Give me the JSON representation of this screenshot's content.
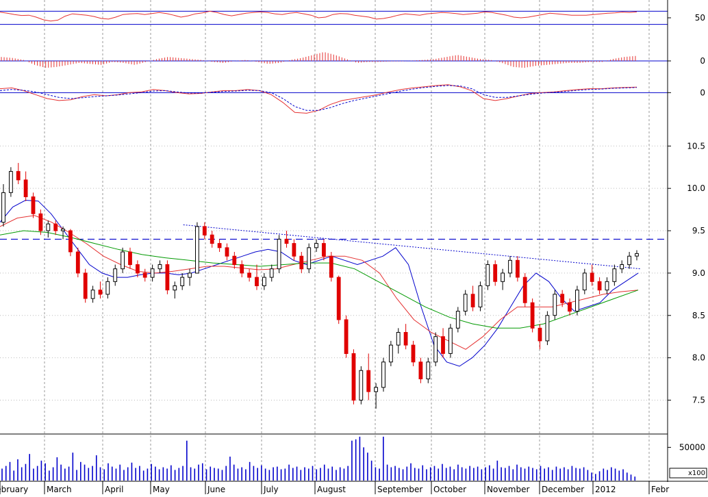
{
  "chart_data": [
    {
      "type": "line",
      "panel": "oscillator",
      "y_ticks": [
        {
          "value": 50,
          "label": "50"
        }
      ],
      "ylim": [
        0,
        100
      ],
      "reference_lines": [
        70,
        30
      ],
      "series": [
        {
          "color": "#e53030",
          "values": [
            67,
            64,
            60,
            57,
            58,
            52,
            44,
            40,
            43,
            55,
            62,
            60,
            58,
            54,
            48,
            46,
            52,
            60,
            62,
            63,
            60,
            63,
            66,
            63,
            58,
            52,
            56,
            62,
            65,
            70,
            66,
            60,
            56,
            60,
            64,
            66,
            68,
            66,
            62,
            60,
            64,
            66,
            62,
            58,
            50,
            52,
            60,
            63,
            62,
            58,
            55,
            52,
            46,
            48,
            52,
            58,
            62,
            60,
            58,
            62,
            64,
            66,
            65,
            63,
            60,
            62,
            64,
            68,
            66,
            62,
            58,
            52,
            50,
            52,
            56,
            60,
            64,
            62,
            60,
            58,
            58,
            58,
            60,
            62,
            64,
            65,
            67,
            66,
            68
          ]
        }
      ]
    },
    {
      "type": "bar",
      "panel": "histogram",
      "y_ticks": [
        {
          "value": 0,
          "label": "0"
        }
      ],
      "ylim": [
        -1,
        1
      ],
      "series": [
        {
          "color": "#e53030",
          "values": [
            0.2,
            0.15,
            0.05,
            -0.2,
            -0.35,
            -0.3,
            -0.2,
            -0.1,
            -0.15,
            -0.2,
            -0.05,
            -0.1,
            -0.2,
            -0.05,
            0.1,
            0.2,
            0.15,
            0.1,
            0.05,
            -0.05,
            -0.1,
            0.0,
            0.05,
            -0.05,
            -0.15,
            -0.1,
            0.05,
            0.15,
            0.3,
            0.45,
            0.3,
            0.1,
            -0.1,
            -0.05,
            -0.05,
            -0.02,
            -0.02,
            0.02,
            0.05,
            0.1,
            0.2,
            0.3,
            0.2,
            0.1,
            0.05,
            -0.1,
            -0.3,
            -0.35,
            -0.25,
            -0.2,
            -0.15,
            -0.1,
            -0.1,
            -0.05,
            -0.05,
            0.1,
            0.2,
            0.25
          ]
        }
      ]
    },
    {
      "type": "line",
      "panel": "macd",
      "y_ticks": [
        {
          "value": 0,
          "label": "0"
        }
      ],
      "ylim": [
        -0.6,
        0.3
      ],
      "series": [
        {
          "color": "#e53030",
          "values": [
            0.1,
            0.12,
            0.05,
            -0.05,
            -0.15,
            -0.2,
            -0.18,
            -0.1,
            -0.05,
            -0.08,
            -0.05,
            0.0,
            0.02,
            0.08,
            0.05,
            0.0,
            -0.03,
            -0.02,
            0.02,
            0.05,
            0.05,
            0.08,
            0.05,
            -0.05,
            -0.25,
            -0.5,
            -0.52,
            -0.45,
            -0.3,
            -0.2,
            -0.15,
            -0.1,
            -0.05,
            0.02,
            0.08,
            0.12,
            0.15,
            0.18,
            0.2,
            0.15,
            0.05,
            -0.15,
            -0.2,
            -0.15,
            -0.08,
            -0.02,
            0.0,
            0.02,
            0.05,
            0.08,
            0.1,
            0.1,
            0.12,
            0.13,
            0.14
          ]
        },
        {
          "color": "#0000cc",
          "dashed": true,
          "values": [
            0.05,
            0.08,
            0.06,
            0.02,
            -0.05,
            -0.12,
            -0.15,
            -0.13,
            -0.1,
            -0.08,
            -0.06,
            -0.03,
            0.0,
            0.04,
            0.05,
            0.02,
            -0.01,
            -0.01,
            0.01,
            0.03,
            0.04,
            0.06,
            0.05,
            0.0,
            -0.15,
            -0.35,
            -0.45,
            -0.45,
            -0.38,
            -0.28,
            -0.2,
            -0.14,
            -0.08,
            -0.02,
            0.04,
            0.09,
            0.13,
            0.16,
            0.18,
            0.17,
            0.1,
            -0.05,
            -0.12,
            -0.12,
            -0.08,
            -0.04,
            -0.01,
            0.01,
            0.03,
            0.06,
            0.08,
            0.09,
            0.11,
            0.12,
            0.13
          ]
        }
      ]
    },
    {
      "type": "candlestick",
      "panel": "price",
      "y_ticks": [
        {
          "value": 10.5,
          "label": "10.5"
        },
        {
          "value": 10.0,
          "label": "10.0"
        },
        {
          "value": 9.5,
          "label": "9.5"
        },
        {
          "value": 9.0,
          "label": "9.0"
        },
        {
          "value": 8.5,
          "label": "8.5"
        },
        {
          "value": 8.0,
          "label": "8.0"
        },
        {
          "value": 7.5,
          "label": "7.5"
        }
      ],
      "ylim": [
        7.1,
        10.85
      ],
      "candles": [
        [
          9.6,
          10.05,
          9.55,
          9.95
        ],
        [
          9.95,
          10.25,
          9.9,
          10.2
        ],
        [
          10.2,
          10.3,
          10.05,
          10.1
        ],
        [
          10.1,
          10.2,
          9.85,
          9.9
        ],
        [
          9.9,
          9.95,
          9.65,
          9.7
        ],
        [
          9.7,
          9.75,
          9.45,
          9.5
        ],
        [
          9.5,
          9.62,
          9.42,
          9.58
        ],
        [
          9.58,
          9.62,
          9.45,
          9.5
        ],
        [
          9.5,
          9.55,
          9.4,
          9.52
        ],
        [
          9.5,
          9.52,
          9.2,
          9.25
        ],
        [
          9.25,
          9.3,
          8.95,
          9.0
        ],
        [
          9.0,
          9.05,
          8.65,
          8.7
        ],
        [
          8.7,
          8.85,
          8.65,
          8.8
        ],
        [
          8.8,
          8.9,
          8.7,
          8.75
        ],
        [
          8.75,
          8.95,
          8.7,
          8.9
        ],
        [
          8.9,
          9.1,
          8.85,
          9.05
        ],
        [
          9.05,
          9.3,
          9.0,
          9.25
        ],
        [
          9.25,
          9.3,
          9.05,
          9.1
        ],
        [
          9.1,
          9.15,
          8.95,
          9.0
        ],
        [
          9.0,
          9.05,
          8.9,
          8.95
        ],
        [
          8.95,
          9.1,
          8.9,
          9.05
        ],
        [
          9.05,
          9.15,
          9.0,
          9.1
        ],
        [
          9.1,
          9.15,
          8.75,
          8.8
        ],
        [
          8.8,
          8.9,
          8.7,
          8.85
        ],
        [
          8.85,
          9.0,
          8.8,
          8.95
        ],
        [
          8.95,
          9.05,
          8.85,
          9.0
        ],
        [
          9.0,
          9.6,
          9.0,
          9.55
        ],
        [
          9.55,
          9.6,
          9.4,
          9.45
        ],
        [
          9.45,
          9.5,
          9.3,
          9.35
        ],
        [
          9.35,
          9.4,
          9.25,
          9.3
        ],
        [
          9.3,
          9.35,
          9.15,
          9.2
        ],
        [
          9.2,
          9.25,
          9.05,
          9.1
        ],
        [
          9.1,
          9.15,
          8.95,
          9.0
        ],
        [
          9.0,
          9.05,
          8.9,
          8.95
        ],
        [
          8.95,
          9.1,
          8.8,
          8.85
        ],
        [
          8.85,
          9.0,
          8.8,
          8.95
        ],
        [
          8.95,
          9.1,
          8.9,
          9.05
        ],
        [
          9.05,
          9.45,
          9.0,
          9.4
        ],
        [
          9.4,
          9.5,
          9.3,
          9.35
        ],
        [
          9.35,
          9.4,
          9.15,
          9.2
        ],
        [
          9.2,
          9.25,
          9.0,
          9.05
        ],
        [
          9.05,
          9.35,
          9.0,
          9.3
        ],
        [
          9.3,
          9.4,
          9.25,
          9.35
        ],
        [
          9.35,
          9.4,
          9.15,
          9.2
        ],
        [
          9.2,
          9.25,
          8.9,
          8.95
        ],
        [
          8.95,
          8.97,
          8.4,
          8.45
        ],
        [
          8.45,
          8.5,
          8.0,
          8.05
        ],
        [
          8.05,
          8.1,
          7.45,
          7.5
        ],
        [
          7.5,
          7.9,
          7.45,
          7.85
        ],
        [
          7.85,
          8.05,
          7.5,
          7.6
        ],
        [
          7.6,
          7.7,
          7.4,
          7.65
        ],
        [
          7.65,
          8.0,
          7.6,
          7.95
        ],
        [
          7.95,
          8.2,
          7.9,
          8.15
        ],
        [
          8.15,
          8.35,
          8.05,
          8.3
        ],
        [
          8.3,
          8.4,
          8.1,
          8.15
        ],
        [
          8.15,
          8.2,
          7.9,
          7.95
        ],
        [
          7.95,
          8.0,
          7.7,
          7.75
        ],
        [
          7.75,
          8.0,
          7.7,
          7.95
        ],
        [
          7.95,
          8.3,
          7.9,
          8.25
        ],
        [
          8.25,
          8.35,
          8.0,
          8.05
        ],
        [
          8.05,
          8.4,
          8.0,
          8.35
        ],
        [
          8.35,
          8.6,
          8.3,
          8.55
        ],
        [
          8.55,
          8.8,
          8.5,
          8.75
        ],
        [
          8.75,
          8.85,
          8.55,
          8.6
        ],
        [
          8.6,
          8.9,
          8.55,
          8.85
        ],
        [
          8.85,
          9.15,
          8.8,
          9.1
        ],
        [
          9.1,
          9.15,
          8.85,
          8.9
        ],
        [
          8.9,
          9.05,
          8.8,
          9.0
        ],
        [
          9.0,
          9.2,
          8.95,
          9.15
        ],
        [
          9.15,
          9.2,
          8.9,
          8.95
        ],
        [
          8.95,
          9.0,
          8.6,
          8.65
        ],
        [
          8.65,
          8.7,
          8.3,
          8.35
        ],
        [
          8.35,
          8.4,
          8.1,
          8.2
        ],
        [
          8.2,
          8.55,
          8.15,
          8.5
        ],
        [
          8.5,
          8.8,
          8.45,
          8.75
        ],
        [
          8.75,
          8.8,
          8.6,
          8.65
        ],
        [
          8.65,
          8.7,
          8.5,
          8.55
        ],
        [
          8.55,
          8.85,
          8.5,
          8.8
        ],
        [
          8.8,
          9.05,
          8.75,
          9.0
        ],
        [
          9.0,
          9.1,
          8.85,
          8.9
        ],
        [
          8.9,
          8.95,
          8.75,
          8.8
        ],
        [
          8.8,
          8.95,
          8.75,
          8.9
        ],
        [
          8.9,
          9.1,
          8.85,
          9.05
        ],
        [
          9.05,
          9.15,
          9.0,
          9.1
        ],
        [
          9.1,
          9.25,
          9.05,
          9.2
        ],
        [
          9.2,
          9.27,
          9.15,
          9.23
        ]
      ],
      "reference_lines": [
        {
          "value": 9.4,
          "color": "#0000cc",
          "style": "dashed"
        }
      ],
      "trendline": {
        "from": [
          9.57,
          0.29
        ],
        "to": [
          9.05,
          0.995
        ],
        "color": "#0000cc"
      },
      "series": [
        {
          "color": "#0000cc",
          "values": [
            9.6,
            9.78,
            9.86,
            9.85,
            9.7,
            9.5,
            9.3,
            9.1,
            9.0,
            8.95,
            8.95,
            8.98,
            9.0,
            9.0,
            8.98,
            9.0,
            9.05,
            9.1,
            9.15,
            9.2,
            9.25,
            9.28,
            9.25,
            9.15,
            9.1,
            9.15,
            9.2,
            9.15,
            9.1,
            9.15,
            9.2,
            9.3,
            9.1,
            8.6,
            8.15,
            7.95,
            7.9,
            8.0,
            8.15,
            8.35,
            8.6,
            8.85,
            9.0,
            8.9,
            8.7,
            8.55,
            8.6,
            8.65,
            8.8,
            8.9,
            9.0
          ]
        },
        {
          "color": "#e53030",
          "values": [
            9.55,
            9.65,
            9.68,
            9.6,
            9.48,
            9.35,
            9.2,
            9.1,
            9.02,
            9.0,
            9.02,
            9.05,
            9.08,
            9.08,
            9.06,
            9.04,
            9.05,
            9.1,
            9.15,
            9.2,
            9.2,
            9.15,
            9.0,
            8.7,
            8.45,
            8.3,
            8.2,
            8.1,
            8.25,
            8.45,
            8.6,
            8.6,
            8.6,
            8.65,
            8.7,
            8.75,
            8.78,
            8.8
          ]
        },
        {
          "color": "#009900",
          "values": [
            9.45,
            9.5,
            9.48,
            9.42,
            9.35,
            9.28,
            9.22,
            9.18,
            9.15,
            9.12,
            9.1,
            9.08,
            9.1,
            9.12,
            9.12,
            9.05,
            8.9,
            8.75,
            8.6,
            8.48,
            8.4,
            8.35,
            8.35,
            8.4,
            8.5,
            8.6,
            8.7,
            8.8
          ]
        }
      ]
    },
    {
      "type": "bar",
      "panel": "volume",
      "y_ticks": [
        {
          "value": 50000,
          "label": "50000"
        }
      ],
      "unit_label": "x100",
      "ylim": [
        0,
        70000
      ],
      "series": [
        {
          "color": "#0000cc",
          "values": [
            18000,
            22000,
            28000,
            15000,
            32000,
            20000,
            25000,
            40000,
            18000,
            22000,
            30000,
            26000,
            15000,
            20000,
            35000,
            24000,
            18000,
            21000,
            42000,
            16000,
            28000,
            24000,
            19000,
            22000,
            38000,
            20000,
            17000,
            26000,
            21000,
            18000,
            24000,
            16000,
            20000,
            27000,
            19000,
            22000,
            15000,
            18000,
            25000,
            21000,
            17000,
            20000,
            18000,
            23000,
            16000,
            19000,
            22000,
            60000,
            20000,
            18000,
            24000,
            26000,
            17000,
            21000,
            19000,
            18000,
            16000,
            22000,
            36000,
            24000,
            18000,
            20000,
            17000,
            28000,
            22000,
            19000,
            23000,
            18000,
            16000,
            20000,
            21000,
            17000,
            18000,
            24000,
            19000,
            21000,
            16000,
            20000,
            18000,
            22000,
            17000,
            19000,
            24000,
            18000,
            21000,
            16000,
            20000,
            18000,
            22000,
            60000,
            62000,
            66000,
            50000,
            42000,
            30000,
            20000,
            18000,
            66000,
            24000,
            20000,
            22000,
            19000,
            17000,
            21000,
            26000,
            19000,
            18000,
            23000,
            17000,
            20000,
            22000,
            18000,
            25000,
            19000,
            21000,
            17000,
            24000,
            20000,
            18000,
            22000,
            19000,
            21000,
            17000,
            20000,
            23000,
            18000,
            30000,
            20000,
            19000,
            22000,
            17000,
            24000,
            20000,
            18000,
            21000,
            19000,
            17000,
            22000,
            18000,
            20000,
            16000,
            21000,
            18000,
            20000,
            17000,
            22000,
            19000,
            18000,
            20000,
            16000,
            12000,
            10000,
            14000,
            18000,
            16000,
            20000,
            18000,
            15000,
            17000,
            12000,
            9000,
            6000
          ]
        }
      ]
    }
  ],
  "x_axis": {
    "months": [
      "February",
      "March",
      "April",
      "May",
      "June",
      "July",
      "August",
      "September",
      "October",
      "November",
      "December",
      "2012",
      "Febr"
    ]
  }
}
